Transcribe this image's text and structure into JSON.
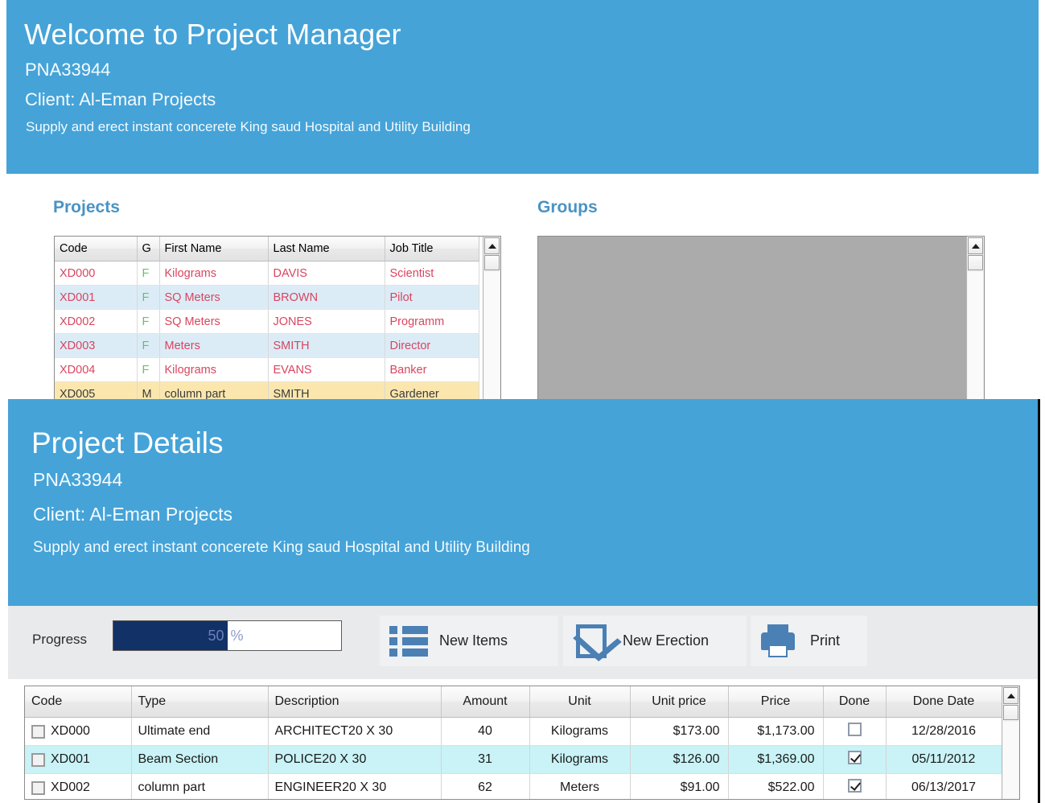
{
  "theme": {
    "header_blue": "#45a3d8",
    "accent_label": "#4a93c4",
    "progress_fill": "#123166",
    "icon_blue": "#4a80b4"
  },
  "welcome_window": {
    "header": {
      "title": "Welcome to Project Manager",
      "code": "PNA33944",
      "client": "Client: Al-Eman Projects",
      "description": "Supply and erect instant concerete King saud Hospital and Utility Building"
    },
    "projects_panel": {
      "label": "Projects",
      "columns": [
        "Code",
        "G",
        "First Name",
        "Last Name",
        "Job Title"
      ],
      "rows": [
        {
          "code": "XD000",
          "g": "F",
          "first_name": "Kilograms",
          "last_name": "DAVIS",
          "job_title": "Scientist"
        },
        {
          "code": "XD001",
          "g": "F",
          "first_name": "SQ Meters",
          "last_name": "BROWN",
          "job_title": "Pilot"
        },
        {
          "code": "XD002",
          "g": "F",
          "first_name": "SQ Meters",
          "last_name": "JONES",
          "job_title": "Programm"
        },
        {
          "code": "XD003",
          "g": "F",
          "first_name": "Meters",
          "last_name": "SMITH",
          "job_title": "Director"
        },
        {
          "code": "XD004",
          "g": "F",
          "first_name": "Kilograms",
          "last_name": "EVANS",
          "job_title": "Banker"
        },
        {
          "code": "XD005",
          "g": "M",
          "first_name": "column part",
          "last_name": "SMITH",
          "job_title": "Gardener"
        }
      ]
    },
    "groups_panel": {
      "label": "Groups",
      "rows": []
    }
  },
  "details_window": {
    "header": {
      "title": "Project Details",
      "code": "PNA33944",
      "client": "Client: Al-Eman Projects",
      "description": "Supply and erect instant concerete King saud Hospital and Utility Building"
    },
    "toolbar": {
      "progress_label": "Progress",
      "progress_value": "50",
      "progress_percent_symbol": "%",
      "buttons": [
        {
          "label": "New Items",
          "icon": "list-icon"
        },
        {
          "label": "New Erection",
          "icon": "checkbox-icon"
        },
        {
          "label": "Print",
          "icon": "printer-icon"
        }
      ]
    },
    "items_grid": {
      "columns": [
        "Code",
        "Type",
        "Description",
        "Amount",
        "Unit",
        "Unit price",
        "Price",
        "Done",
        "Done Date"
      ],
      "rows": [
        {
          "selected": false,
          "code": "XD000",
          "type": "Ultimate end",
          "description": "ARCHITECT20 X 30",
          "amount": "40",
          "unit": "Kilograms",
          "unit_price": "$173.00",
          "price": "$1,173.00",
          "done": false,
          "done_date": "12/28/2016"
        },
        {
          "selected": false,
          "code": "XD001",
          "type": "Beam Section",
          "description": "POLICE20 X 30",
          "amount": "31",
          "unit": "Kilograms",
          "unit_price": "$126.00",
          "price": "$1,369.00",
          "done": true,
          "done_date": "05/11/2012"
        },
        {
          "selected": false,
          "code": "XD002",
          "type": "column part",
          "description": "ENGINEER20 X 30",
          "amount": "62",
          "unit": "Meters",
          "unit_price": "$91.00",
          "price": "$522.00",
          "done": true,
          "done_date": "06/13/2017"
        }
      ]
    }
  }
}
